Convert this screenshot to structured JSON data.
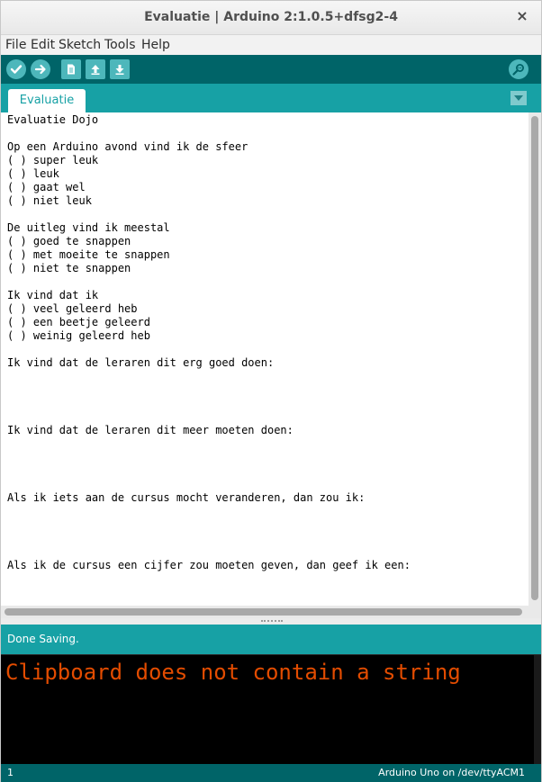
{
  "window": {
    "title": "Evaluatie | Arduino 2:1.0.5+dfsg2-4",
    "close_icon": "×"
  },
  "menu": {
    "items": [
      "File",
      "Edit",
      "Sketch",
      "Tools",
      "Help"
    ]
  },
  "toolbar": {
    "buttons": [
      "verify-icon",
      "upload-icon",
      "new-icon",
      "open-icon",
      "save-icon",
      "serial-monitor-icon"
    ]
  },
  "tabs": {
    "items": [
      {
        "label": "Evaluatie"
      }
    ],
    "menu_icon": "chevron-down-icon"
  },
  "editor": {
    "lines": [
      "Evaluatie Dojo",
      "",
      "Op een Arduino avond vind ik de sfeer",
      "( ) super leuk",
      "( ) leuk",
      "( ) gaat wel",
      "( ) niet leuk",
      "",
      "De uitleg vind ik meestal",
      "( ) goed te snappen",
      "( ) met moeite te snappen",
      "( ) niet te snappen",
      "",
      "Ik vind dat ik",
      "( ) veel geleerd heb",
      "( ) een beetje geleerd",
      "( ) weinig geleerd heb",
      "",
      "Ik vind dat de leraren dit erg goed doen:",
      "",
      "",
      "",
      "",
      "Ik vind dat de leraren dit meer moeten doen:",
      "",
      "",
      "",
      "",
      "Als ik iets aan de cursus mocht veranderen, dan zou ik:",
      "",
      "",
      "",
      "",
      "Als ik de cursus een cijfer zou moeten geven, dan geef ik een:"
    ]
  },
  "status": {
    "message": "Done Saving."
  },
  "console": {
    "message": "Clipboard does not contain a string"
  },
  "footer": {
    "line_number": "1",
    "board": "Arduino Uno on /dev/ttyACM1"
  },
  "colors": {
    "toolbar": "#006468",
    "tabbar": "#17a1a5",
    "console_text": "#e34c00"
  }
}
